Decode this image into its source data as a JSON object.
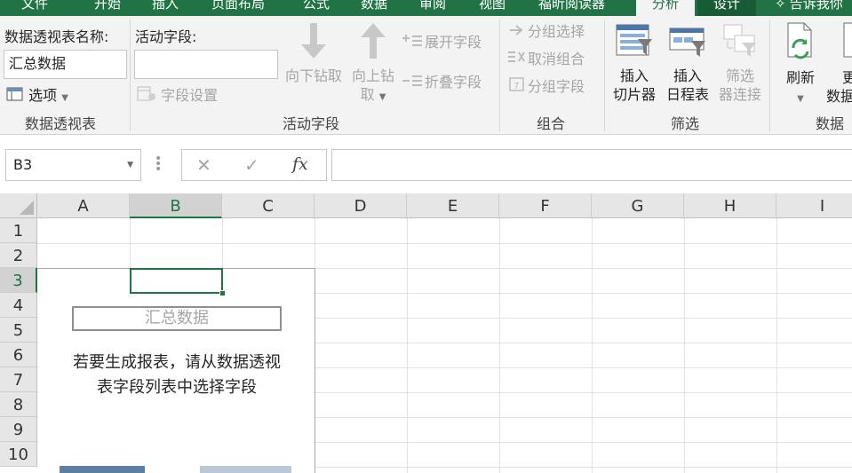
{
  "tabs": [
    {
      "label": "文件"
    },
    {
      "label": "开始"
    },
    {
      "label": "插入"
    },
    {
      "label": "页面布局"
    },
    {
      "label": "公式"
    },
    {
      "label": "数据"
    },
    {
      "label": "审阅"
    },
    {
      "label": "视图"
    },
    {
      "label": "福昕阅读器"
    },
    {
      "label": "分析"
    },
    {
      "label": "设计"
    },
    {
      "label": "告诉我你"
    }
  ],
  "active_tab": "分析",
  "ribbon": {
    "pivot_table": {
      "name_label": "数据透视表名称:",
      "name_value": "汇总数据",
      "options_label": "选项",
      "group_label": "数据透视表"
    },
    "active_field": {
      "label": "活动字段:",
      "value": "",
      "field_settings": "字段设置",
      "drill_down": "向下钻取",
      "drill_up_line1": "向上钻",
      "drill_up_line2": "取",
      "expand_field": "展开字段",
      "collapse_field": "折叠字段",
      "group_label": "活动字段"
    },
    "group": {
      "group_selection": "分组选择",
      "ungroup": "取消组合",
      "group_field": "分组字段",
      "group_label": "组合"
    },
    "filter": {
      "insert_slicer_line1": "插入",
      "insert_slicer_line2": "切片器",
      "insert_timeline_line1": "插入",
      "insert_timeline_line2": "日程表",
      "filter_connections_line1": "筛选",
      "filter_connections_line2": "器连接",
      "group_label": "筛选"
    },
    "data": {
      "refresh": "刷新",
      "change_source_line1": "更",
      "change_source_line2": "数据",
      "group_label": "数据"
    }
  },
  "formula_bar": {
    "name_box": "B3",
    "cancel": "✕",
    "enter": "✓",
    "fx": "fx",
    "formula": ""
  },
  "sheet": {
    "columns": [
      "A",
      "B",
      "C",
      "D",
      "E",
      "F",
      "G",
      "H",
      "I"
    ],
    "rows": [
      "1",
      "2",
      "3",
      "4",
      "5",
      "6",
      "7",
      "8",
      "9",
      "10"
    ],
    "selected_column": "B",
    "selected_row": "3",
    "pivot_placeholder_title": "汇总数据",
    "pivot_message_line1": "若要生成报表，请从数据透视",
    "pivot_message_line2": "表字段列表中选择字段"
  },
  "colors": {
    "accent": "#217346",
    "ribbon_bg": "#f3f3f3",
    "disabled_text": "#a6a6a6"
  }
}
